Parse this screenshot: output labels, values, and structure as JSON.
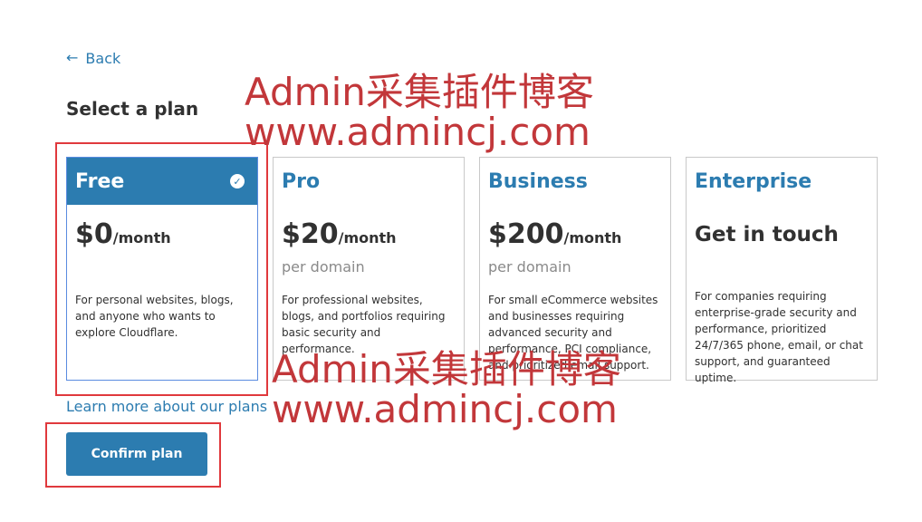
{
  "nav": {
    "back_icon": "←",
    "back_label": "Back"
  },
  "page": {
    "title": "Select a plan"
  },
  "plans": [
    {
      "name": "Free",
      "price": "$0",
      "period": "/month",
      "per_domain": "",
      "description": "For personal websites, blogs, and anyone who wants to explore Cloudflare.",
      "selected": true
    },
    {
      "name": "Pro",
      "price": "$20",
      "period": "/month",
      "per_domain": "per domain",
      "description": "For professional websites, blogs, and portfolios requiring basic security and performance.",
      "selected": false
    },
    {
      "name": "Business",
      "price": "$200",
      "period": "/month",
      "per_domain": "per domain",
      "description": "For small eCommerce websites and businesses requiring advanced security and performance, PCI compliance, and prioritized email support.",
      "selected": false
    },
    {
      "name": "Enterprise",
      "cta": "Get in touch",
      "description": "For companies requiring enterprise-grade security and performance, prioritized 24/7/365 phone, email, or chat support, and guaranteed uptime.",
      "selected": false
    }
  ],
  "check_icon": "✓",
  "learn_more": "Learn more about our plans",
  "confirm_label": "Confirm plan",
  "watermarks": [
    {
      "line1": "Admin采集插件博客",
      "line2": "www.admincj.com"
    },
    {
      "line1": "Admin采集插件博客",
      "line2": "www.admincj.com"
    }
  ],
  "colors": {
    "accent": "#2c7cb0",
    "highlight": "#e0393d",
    "watermark": "#c2373a"
  }
}
